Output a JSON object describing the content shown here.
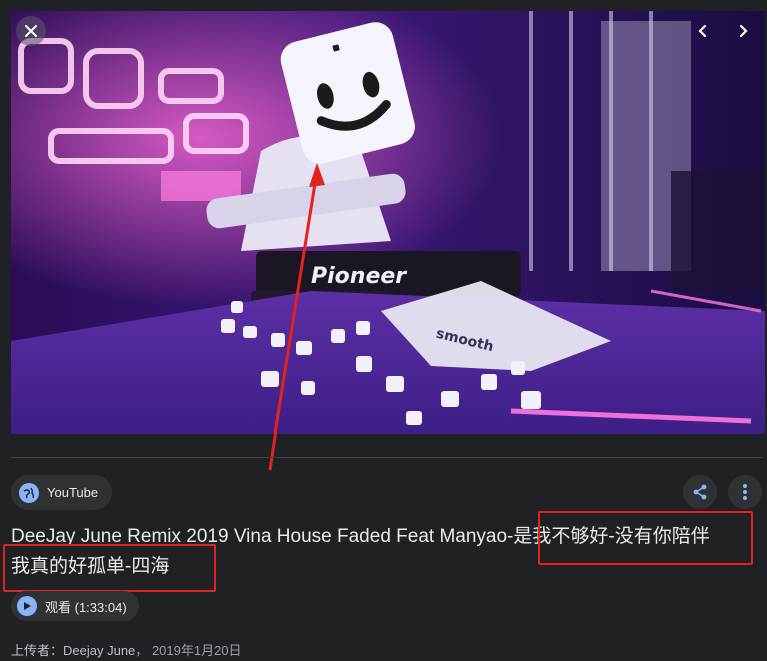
{
  "source": {
    "name": "YouTube",
    "icon": "globe-icon"
  },
  "title": {
    "part1": "DeeJay June Remix 2019 Vina House Faded Feat Manyao-",
    "part2": "是我不够好-没有你陪伴",
    "part3": "我真的好孤单-四海"
  },
  "watch": {
    "label": "观看 (1:33:04)",
    "icon": "play-icon"
  },
  "uploader": {
    "label": "上传者：",
    "name": "Deejay June",
    "separator": "，",
    "date": "2019年1月20日"
  },
  "hero": {
    "brand_text": "Pioneer",
    "bag_text": "smooth"
  },
  "controls": {
    "close_icon": "close-icon",
    "prev_icon": "chevron-left-icon",
    "next_icon": "chevron-right-icon",
    "share_icon": "share-icon",
    "more_icon": "more-vert-icon"
  },
  "colors": {
    "background": "#202124",
    "chip": "#303134",
    "accent": "#8ab4f8",
    "highlight": "#e0241b"
  }
}
